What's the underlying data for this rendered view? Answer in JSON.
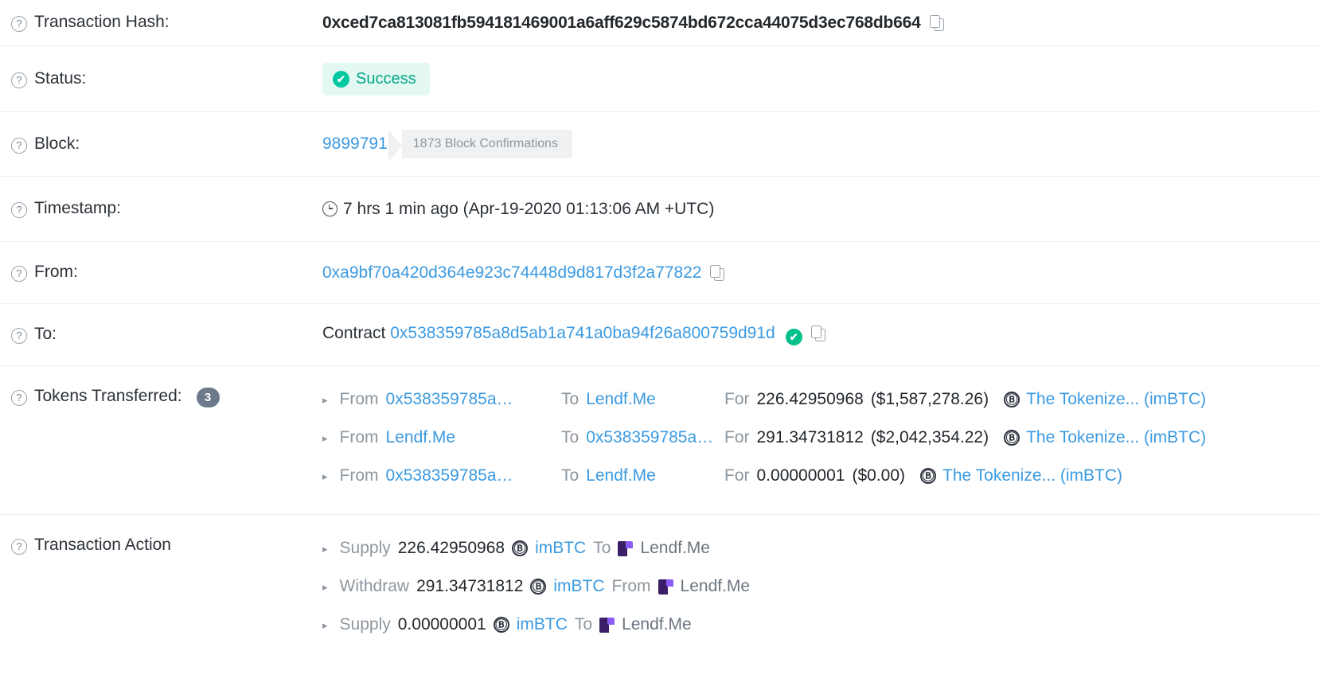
{
  "rows": {
    "transaction_hash": {
      "label": "Transaction Hash:",
      "value": "0xced7ca813081fb594181469001a6aff629c5874bd672cca44075d3ec768db664",
      "copy_icon": "copy-icon"
    },
    "status": {
      "label": "Status:",
      "value": "Success",
      "icon": "check-circle-icon"
    },
    "block": {
      "label": "Block:",
      "number": "9899791",
      "confirmations": "1873 Block Confirmations"
    },
    "timestamp": {
      "label": "Timestamp:",
      "icon": "clock-icon",
      "value": "7 hrs 1 min ago (Apr-19-2020 01:13:06 AM +UTC)"
    },
    "from": {
      "label": "From:",
      "address": "0xa9bf70a420d364e923c74448d9d817d3f2a77822",
      "copy_icon": "copy-icon"
    },
    "to": {
      "label": "To:",
      "prefix": "Contract",
      "address": "0x538359785a8d5ab1a741a0ba94f26a800759d91d",
      "verified_icon": "verified-check-icon",
      "copy_icon": "copy-icon"
    },
    "tokens_transferred": {
      "label": "Tokens Transferred:",
      "count": "3",
      "word_from": "From",
      "word_to": "To",
      "word_for": "For",
      "transfers": [
        {
          "from": "0x538359785a…",
          "to": "Lendf.Me",
          "amount": "226.42950968",
          "usd": "($1,587,278.26)",
          "token": "The Tokenize... (imBTC)"
        },
        {
          "from": "Lendf.Me",
          "to": "0x538359785a…",
          "amount": "291.34731812",
          "usd": "($2,042,354.22)",
          "token": "The Tokenize... (imBTC)"
        },
        {
          "from": "0x538359785a…",
          "to": "Lendf.Me",
          "amount": "0.00000001",
          "usd": "($0.00)",
          "token": "The Tokenize... (imBTC)"
        }
      ]
    },
    "transaction_action": {
      "label": "Transaction Action",
      "actions": [
        {
          "verb": "Supply",
          "amount": "226.42950968",
          "token": "imBTC",
          "preposition": "To",
          "venue": "Lendf.Me"
        },
        {
          "verb": "Withdraw",
          "amount": "291.34731812",
          "token": "imBTC",
          "preposition": "From",
          "venue": "Lendf.Me"
        },
        {
          "verb": "Supply",
          "amount": "0.00000001",
          "token": "imBTC",
          "preposition": "To",
          "venue": "Lendf.Me"
        }
      ]
    }
  },
  "colors": {
    "link": "#3b9ae1",
    "success_text": "#00a884",
    "success_bg": "#e4f8f3",
    "muted": "#8d969e",
    "badge_bg": "#6c7a89",
    "divider": "#eceff1"
  }
}
